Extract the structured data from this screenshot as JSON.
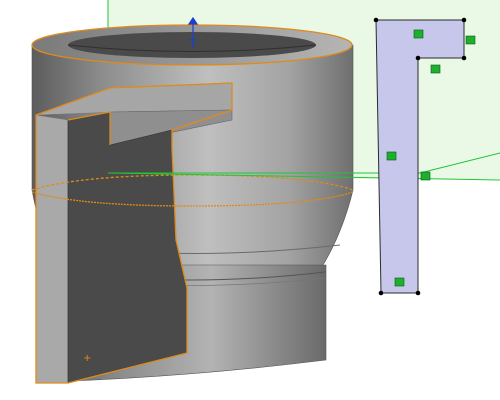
{
  "viewport": {
    "background": "#ffffff",
    "sketch_plane_color": "#eaf8e6",
    "axis_line_color": "#22c43a",
    "highlight_edge_color": "#e08a1a",
    "profile_fill_color": "#c7c7ec",
    "constraint_marker_color": "#1db02f"
  },
  "tags": {
    "partial_label_text": "",
    "origin_marker": "+"
  }
}
